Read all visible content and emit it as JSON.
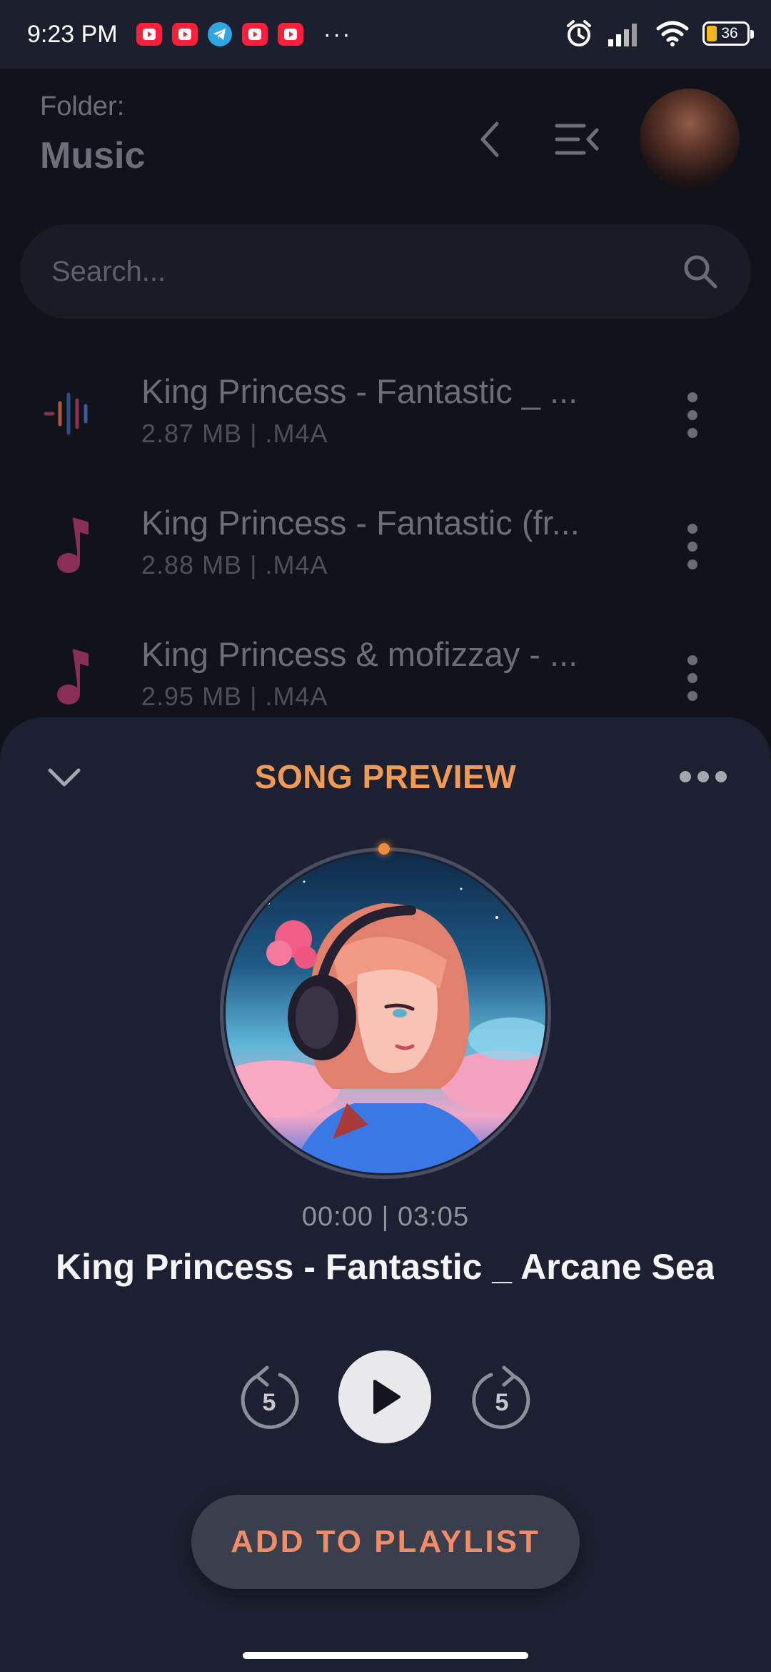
{
  "status_bar": {
    "time": "9:23 PM",
    "notifications": [
      "youtube-icon",
      "youtube-icon",
      "telegram-icon",
      "youtube-icon",
      "youtube-icon"
    ],
    "more": "···",
    "battery": "36",
    "colors": {
      "youtube": "#ff1f3a",
      "telegram": "#2ea6df",
      "battery": "#f5b51b"
    }
  },
  "header": {
    "folder_label": "Folder:",
    "folder_name": "Music"
  },
  "search": {
    "placeholder": "Search..."
  },
  "files": [
    {
      "title": "King Princess - Fantastic _ ...",
      "size": "2.87 MB",
      "ext": ".M4A",
      "icon": "waveform-icon"
    },
    {
      "title": "King Princess - Fantastic (fr...",
      "size": "2.88 MB",
      "ext": ".M4A",
      "icon": "music-note-icon"
    },
    {
      "title": "King Princess & mofizzay - ...",
      "size": "2.95 MB",
      "ext": ".M4A",
      "icon": "music-note-icon"
    }
  ],
  "preview": {
    "title": "SONG PREVIEW",
    "time": "00:00 | 03:05",
    "song_title": "King Princess - Fantastic _ Arcane Sea",
    "rewind_seconds": "5",
    "forward_seconds": "5",
    "add_to_playlist": "ADD TO PLAYLIST",
    "progress": 0.0,
    "accent_color": "#ef9a55"
  }
}
